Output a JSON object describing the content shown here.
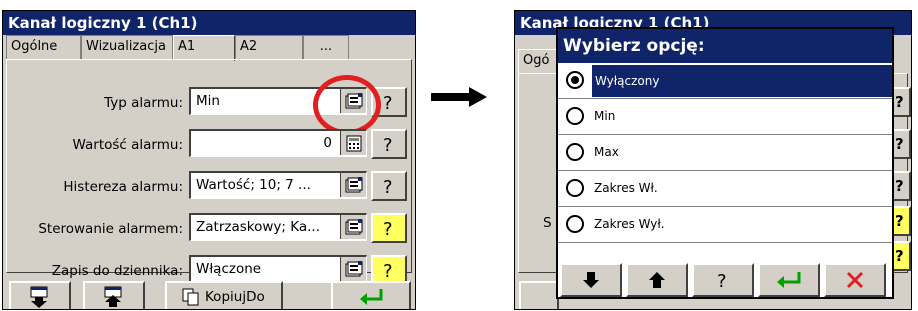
{
  "left_window": {
    "title": "Kanał logiczny 1 (Ch1)",
    "tabs": [
      {
        "label": "Ogólne"
      },
      {
        "label": "Wizualizacja"
      },
      {
        "label": "A1"
      },
      {
        "label": "A2"
      },
      {
        "label": "..."
      }
    ],
    "active_tab": "A1",
    "fields": [
      {
        "label": "Typ alarmu:",
        "value": "Min"
      },
      {
        "label": "Wartość alarmu:",
        "value": "0"
      },
      {
        "label": "Histereza alarmu:",
        "value": "Wartość; 10; 7 ..."
      },
      {
        "label": "Sterowanie alarmem:",
        "value": "Zatrzaskowy; Ka..."
      },
      {
        "label": "Zapis do dziennika:",
        "value": "Włączone"
      }
    ],
    "bottom_bar": {
      "copy_label": "KopiujDo"
    },
    "highlight_color": "#e02020"
  },
  "right_window": {
    "title": "Kanał logiczny 1 (Ch1)",
    "tab_fragment": "Ogó",
    "side_label": "S"
  },
  "dialog": {
    "title": "Wybierz opcję:",
    "options": [
      {
        "label": "Wyłączony",
        "selected": true
      },
      {
        "label": "Min",
        "selected": false
      },
      {
        "label": "Max",
        "selected": false
      },
      {
        "label": "Zakres Wł.",
        "selected": false
      },
      {
        "label": "Zakres Wył.",
        "selected": false
      }
    ],
    "buttons": [
      "down-arrow-icon",
      "up-arrow-icon",
      "help-icon",
      "enter-icon",
      "close-icon"
    ]
  },
  "colors": {
    "titlebar": "#10246a",
    "window": "#d4d0c8",
    "help_button_active": "#ffff60",
    "enter_icon": "#00a000",
    "close_icon": "#e02020"
  }
}
